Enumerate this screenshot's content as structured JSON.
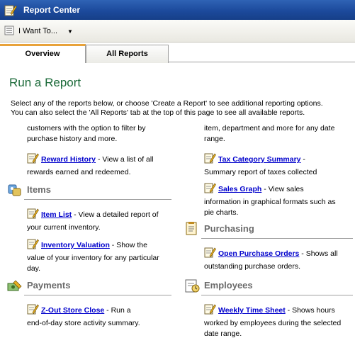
{
  "window": {
    "title": "Report Center"
  },
  "toolbar": {
    "menu_label": "I Want To..."
  },
  "tabs": [
    {
      "label": "Overview"
    },
    {
      "label": "All Reports"
    }
  ],
  "page": {
    "title": "Run a Report",
    "intro_line1": "Select any of the reports below, or choose 'Create a Report' to see additional reporting options.",
    "intro_line2": "You can also select the 'All Reports' tab at the top of this page to see all available reports."
  },
  "left": {
    "fragment_line1": "customers with the option to filter by",
    "fragment_line2": "purchase history and more.",
    "reward_history": {
      "link": "Reward History",
      "desc_line1": " - View a list of all",
      "desc_line2": "rewards earned and redeemed."
    },
    "items_section": {
      "title": "Items"
    },
    "item_list": {
      "link": "Item List",
      "desc_line1": " - View a detailed report of",
      "desc_line2": "your current inventory."
    },
    "inventory_valuation": {
      "link": "Inventory Valuation",
      "desc_line1": " - Show the",
      "desc_line2": "value of your inventory for any particular",
      "desc_line3": "day."
    },
    "payments_section": {
      "title": "Payments"
    },
    "z_out": {
      "link": "Z-Out Store Close",
      "desc_line1": " - Run a",
      "desc_line2": "end-of-day store activity summary."
    }
  },
  "right": {
    "fragment_line1": "item, department and more for any date",
    "fragment_line2": "range.",
    "tax_category": {
      "link": "Tax Category Summary",
      "desc_line1": " -",
      "desc_line2": "Summary report of taxes collected"
    },
    "sales_graph": {
      "link": "Sales Graph",
      "desc_line1": " - View sales",
      "desc_line2": "information in graphical formats such as",
      "desc_line3": "pie charts."
    },
    "purchasing_section": {
      "title": "Purchasing"
    },
    "open_po": {
      "link": "Open Purchase Orders",
      "desc_line1": " - Shows all",
      "desc_line2": "outstanding purchase orders."
    },
    "employees_section": {
      "title": "Employees"
    },
    "weekly_time": {
      "link": "Weekly Time Sheet",
      "desc_line1": " - Shows hours",
      "desc_line2": "worked by employees during the selected",
      "desc_line3": "date range."
    }
  },
  "colors": {
    "title_green": "#1b6a39",
    "link_blue": "#0000cc",
    "section_gray": "#6b6b6b",
    "tab_accent": "#e8a23a",
    "titlebar_blue": "#1c4a9c"
  },
  "icons": {
    "app": "report-pencil-icon",
    "menu": "list-menu-icon",
    "report": "report-pencil-icon",
    "items": "items-icon",
    "payments": "payments-icon",
    "purchasing": "purchasing-icon",
    "employees": "employees-icon"
  }
}
